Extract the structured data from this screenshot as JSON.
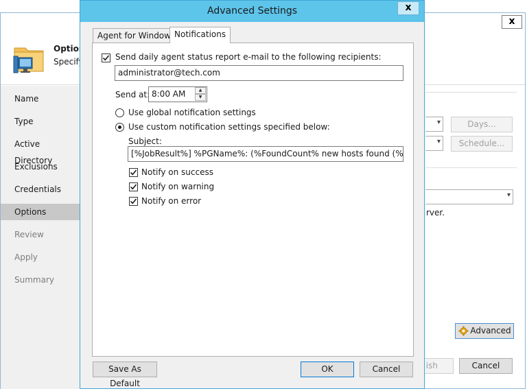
{
  "background_wizard": {
    "close_glyph": "x",
    "header": {
      "title": "Option",
      "subtitle": "Specify"
    },
    "nav": [
      {
        "label": "Name",
        "state": "normal"
      },
      {
        "label": "Type",
        "state": "normal"
      },
      {
        "label": "Active Directory",
        "state": "normal"
      },
      {
        "label": "Exclusions",
        "state": "normal"
      },
      {
        "label": "Credentials",
        "state": "normal"
      },
      {
        "label": "Options",
        "state": "active"
      },
      {
        "label": "Review",
        "state": "dim"
      },
      {
        "label": "Apply",
        "state": "dim"
      },
      {
        "label": "Summary",
        "state": "dim"
      }
    ],
    "days_button": "Days...",
    "schedule_button": "Schedule...",
    "partial_text": "rver.",
    "advanced_button": "Advanced",
    "finish_button_partial": "ish",
    "cancel_button": "Cancel"
  },
  "dialog": {
    "title": "Advanced Settings",
    "close_glyph": "x",
    "tabs": [
      {
        "label": "Agent for Windows",
        "active": false
      },
      {
        "label": "Notifications",
        "active": true
      }
    ],
    "send_report_label": "Send daily agent status report e-mail to the following recipients:",
    "send_report_checked": true,
    "recipients_value": "administrator@tech.com",
    "send_at_label": "Send at:",
    "send_at_value": "8:00 AM",
    "radio_global_label": "Use global notification settings",
    "radio_custom_label": "Use custom notification settings specified below:",
    "selected_radio": "custom",
    "subject_label": "Subject:",
    "subject_value": "[%JobResult%] %PGName%: (%FoundCount% new hosts found (%TotalCo",
    "notify_success_label": "Notify on success",
    "notify_warning_label": "Notify on warning",
    "notify_error_label": "Notify on error",
    "notify_success_checked": true,
    "notify_warning_checked": true,
    "notify_error_checked": true,
    "save_default_button": "Save As Default",
    "ok_button": "OK",
    "cancel_button": "Cancel"
  },
  "colors": {
    "dialog_titlebar": "#5dc4ea",
    "dialog_border": "#42a5d8",
    "selected_nav": "#c8c8c8"
  }
}
